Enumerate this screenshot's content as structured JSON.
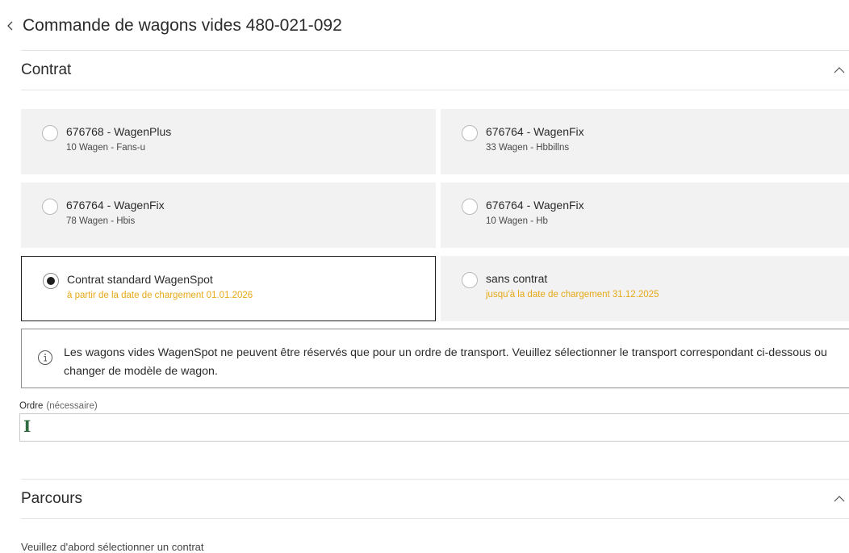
{
  "header": {
    "title": "Commande de wagons vides 480-021-092"
  },
  "contrat": {
    "title": "Contrat",
    "options": [
      {
        "title": "676768 - WagenPlus",
        "subtitle": "10 Wagen - Fans-u",
        "selected": false
      },
      {
        "title": "676764 - WagenFix",
        "subtitle": "33 Wagen - Hbbillns",
        "selected": false
      },
      {
        "title": "676764 - WagenFix",
        "subtitle": "78 Wagen - Hbis",
        "selected": false
      },
      {
        "title": "676764 - WagenFix",
        "subtitle": "10 Wagen - Hb",
        "selected": false
      },
      {
        "title": "Contrat standard WagenSpot",
        "subtitle": "à partir de la date de chargement 01.01.2026",
        "selected": true
      },
      {
        "title": "sans contrat",
        "subtitle": "jusqu'à la date de chargement 31.12.2025",
        "selected": false
      }
    ],
    "info": "Les wagons vides WagenSpot ne peuvent être réservés que pour un ordre de transport. Veuillez sélectionner le transport correspondant ci-dessous ou changer de modèle de wagon.",
    "ordre": {
      "label": "Ordre",
      "required": "(nécessaire)",
      "value": ""
    }
  },
  "parcours": {
    "title": "Parcours",
    "hint": "Veuillez d'abord sélectionner un contrat"
  },
  "colors": {
    "accent_warning": "#e6a817",
    "selected_border": "#1e1e1e",
    "card_bg": "#f2f2f2"
  }
}
